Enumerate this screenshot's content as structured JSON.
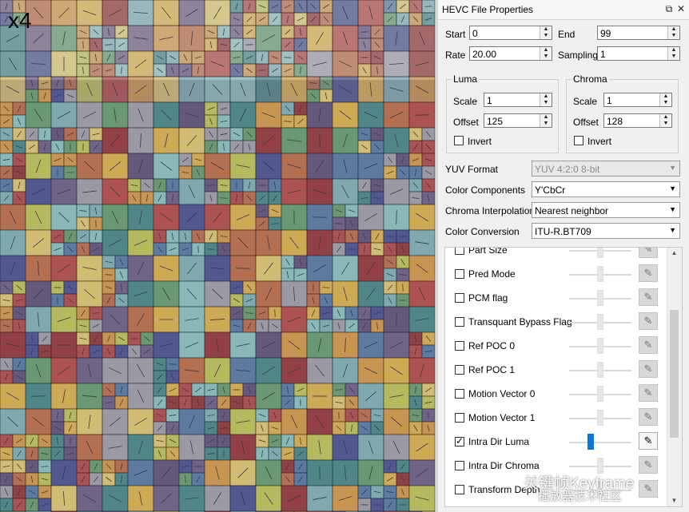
{
  "viewer": {
    "zoom_label": "x4"
  },
  "panel": {
    "title": "HEVC File Properties",
    "start": {
      "label": "Start",
      "value": "0"
    },
    "end": {
      "label": "End",
      "value": "99"
    },
    "rate": {
      "label": "Rate",
      "value": "20.00"
    },
    "sampling": {
      "label": "Sampling",
      "value": "1"
    },
    "luma": {
      "title": "Luma",
      "scale_label": "Scale",
      "scale": "1",
      "offset_label": "Offset",
      "offset": "125",
      "invert_label": "Invert"
    },
    "chroma": {
      "title": "Chroma",
      "scale_label": "Scale",
      "scale": "1",
      "offset_label": "Offset",
      "offset": "128",
      "invert_label": "Invert"
    },
    "yuv_format": {
      "label": "YUV Format",
      "value": "YUV 4:2:0 8-bit"
    },
    "color_components": {
      "label": "Color Components",
      "value": "Y'CbCr"
    },
    "chroma_interp": {
      "label": "Chroma Interpolation",
      "value": "Nearest neighbor"
    },
    "color_conversion": {
      "label": "Color Conversion",
      "value": "ITU-R.BT709"
    }
  },
  "overlays": [
    {
      "label": "Part Size",
      "checked": false,
      "active": false
    },
    {
      "label": "Pred Mode",
      "checked": false,
      "active": false
    },
    {
      "label": "PCM flag",
      "checked": false,
      "active": false
    },
    {
      "label": "Transquant Bypass Flag",
      "checked": false,
      "active": false
    },
    {
      "label": "Ref POC 0",
      "checked": false,
      "active": false
    },
    {
      "label": "Ref POC 1",
      "checked": false,
      "active": false
    },
    {
      "label": "Motion Vector 0",
      "checked": false,
      "active": false
    },
    {
      "label": "Motion Vector 1",
      "checked": false,
      "active": false
    },
    {
      "label": "Intra Dir Luma",
      "checked": true,
      "active": true
    },
    {
      "label": "Intra Dir Chroma",
      "checked": false,
      "active": false
    },
    {
      "label": "Transform Depth",
      "checked": false,
      "active": false
    }
  ],
  "watermark": {
    "line1": "关键帧Keyframe",
    "line2": "播放器技术社区"
  },
  "colors": {
    "accent": "#0a78d7"
  },
  "icons": {
    "pen": "pencil-icon",
    "float": "float-window-icon",
    "close": "close-icon"
  }
}
